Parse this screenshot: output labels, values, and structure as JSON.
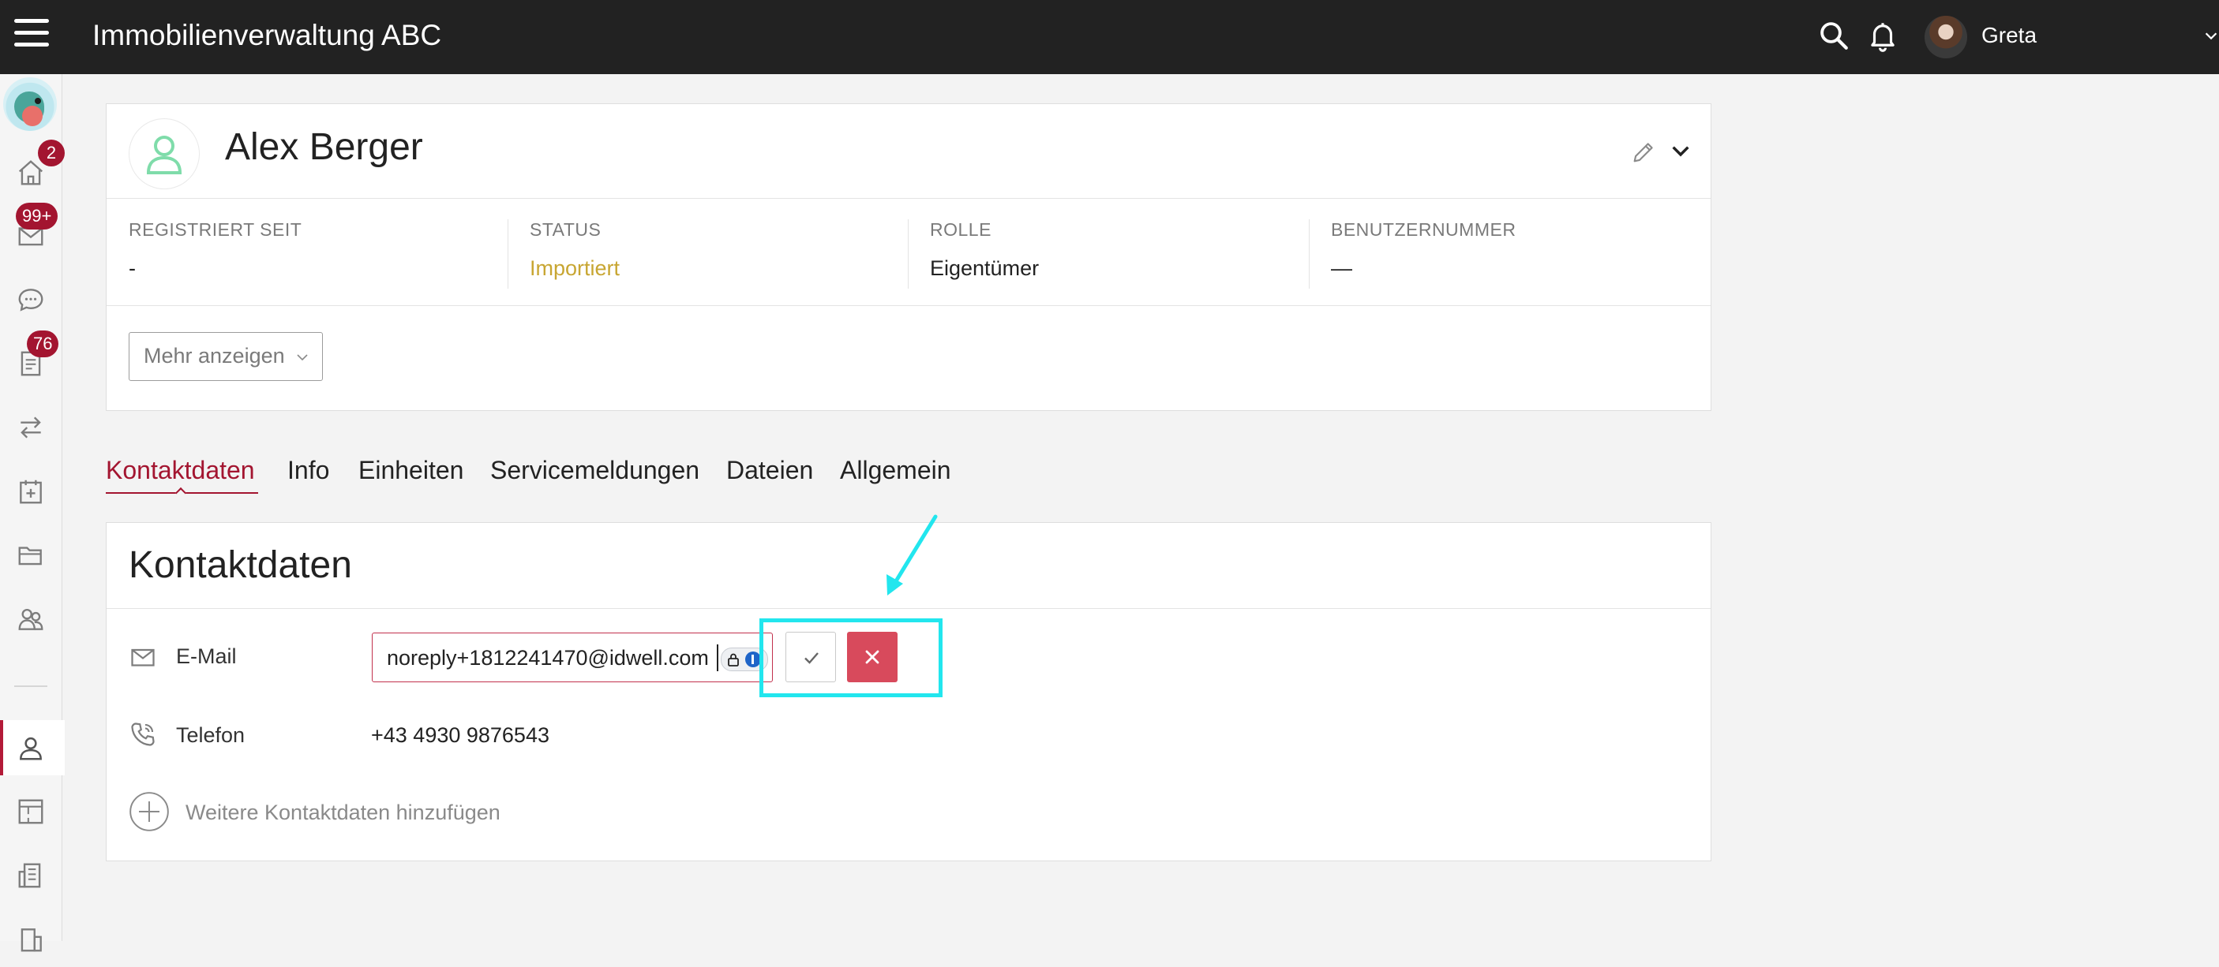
{
  "app": {
    "title": "Immobilienverwaltung ABC",
    "user_name": "Greta"
  },
  "sidebar": {
    "badges": {
      "home": "2",
      "mail": "99+",
      "documents": "76"
    },
    "active_item": "contacts"
  },
  "profile": {
    "name": "Alex Berger",
    "fields": [
      {
        "label": "REGISTRIERT SEIT",
        "value": "-"
      },
      {
        "label": "STATUS",
        "value": "Importiert"
      },
      {
        "label": "ROLLE",
        "value": "Eigentümer"
      },
      {
        "label": "BENUTZERNUMMER",
        "value": "—"
      }
    ],
    "more_button": "Mehr anzeigen"
  },
  "tabs": [
    {
      "label": "Kontaktdaten",
      "active": true
    },
    {
      "label": "Info"
    },
    {
      "label": "Einheiten"
    },
    {
      "label": "Servicemeldungen"
    },
    {
      "label": "Dateien"
    },
    {
      "label": "Allgemein"
    }
  ],
  "contact": {
    "title": "Kontaktdaten",
    "email_label": "E-Mail",
    "email_value": "noreply+1812241470@idwell.com",
    "phone_label": "Telefon",
    "phone_value": "+43 4930 9876543",
    "add_label": "Weitere Kontaktdaten hinzufügen"
  },
  "colors": {
    "accent": "#a31530",
    "status": "#c8a632",
    "cancel": "#d84a5c",
    "highlight": "#22e6ee",
    "avatar_green": "#7fdcaa"
  }
}
